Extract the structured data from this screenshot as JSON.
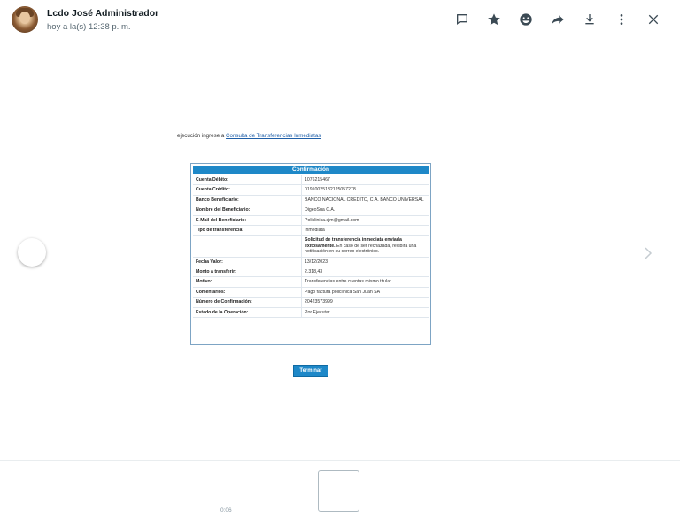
{
  "header": {
    "contact_name": "Lcdo José Administrador",
    "timestamp": "hoy a la(s) 12:38 p. m.",
    "actions": [
      {
        "name": "reply-icon"
      },
      {
        "name": "star-icon"
      },
      {
        "name": "emoji-icon"
      },
      {
        "name": "forward-icon"
      },
      {
        "name": "download-icon"
      },
      {
        "name": "more-icon"
      },
      {
        "name": "close-icon"
      }
    ]
  },
  "document": {
    "intro_text": "ejecución ingrese a ",
    "intro_link": "Consulta de Transferencias Inmediatas",
    "confirmation_title": "Confirmación",
    "rows": [
      {
        "label": "Cuenta Débito:",
        "value": "1076215467"
      },
      {
        "label": "Cuenta Crédito:",
        "value": "01910025132125057278"
      },
      {
        "label": "Banco Beneficiario:",
        "value": "BANCO NACIONAL CRÉDITO, C.A. BANCO UNIVERSAL"
      },
      {
        "label": "Nombre del Beneficiario:",
        "value": "DigeoSua C.A."
      },
      {
        "label": "E-Mail del Beneficiario:",
        "value": "Policlinica.sjm@gmail.com"
      },
      {
        "label": "Tipo de transferencia:",
        "value": "Inmediata"
      },
      {
        "label": "",
        "value_bold": "Solicitud de transferencia inmediata enviada exitosamente.",
        "value": " En caso de ser rechazada, recibirá una notificación en su correo electrónico."
      },
      {
        "label": "Fecha Valor:",
        "value": "13/12/2023"
      },
      {
        "label": "Monto a transferir:",
        "value": "2.318,43"
      },
      {
        "label": "Motivo:",
        "value": "Transferencias entre cuentas mismo titular"
      },
      {
        "label": "Comentarios:",
        "value": "Pago factura policlinica San Juan SA"
      },
      {
        "label": "Número de Confirmación:",
        "value": "20423573999"
      },
      {
        "label": "Estado de la Operación:",
        "value": "Por Ejecutar"
      }
    ],
    "finish_button": "Terminar"
  },
  "footer": {
    "thumb_duration": "0:06"
  },
  "colors": {
    "accent_blue": "#1e88c8",
    "icon_gray": "#3b4a54"
  }
}
